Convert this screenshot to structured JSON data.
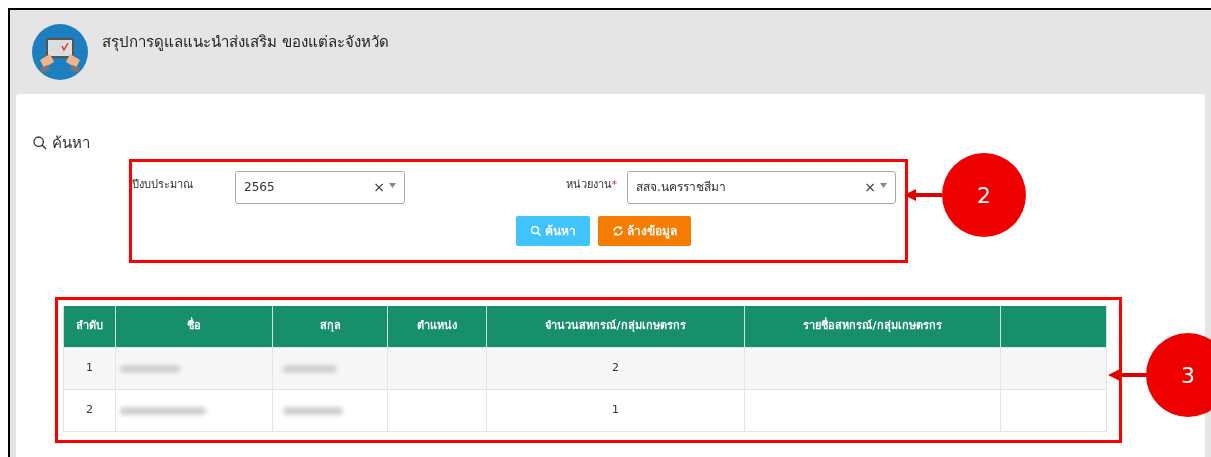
{
  "header": {
    "title": "สรุปการดูแลแนะนำส่งเสริม ของแต่ละจังหวัด"
  },
  "search": {
    "heading": "ค้นหา",
    "fields": [
      {
        "label": "ปีงบประมาณ",
        "value": "2565",
        "clear": "×"
      },
      {
        "label": "หน่วยงาน",
        "required_mark": "*",
        "value": "สสจ.นครราชสีมา",
        "clear": "×"
      }
    ],
    "buttons": [
      {
        "kind": "search",
        "label": "ค้นหา"
      },
      {
        "kind": "reset",
        "label": "ล้างข้อมูล"
      }
    ]
  },
  "table": {
    "columns": [
      "ลำดับ",
      "ชื่อ",
      "สกุล",
      "ตำแหน่ง",
      "จำนวนสหกรณ์/กลุ่มเกษตรกร",
      "รายชื่อสหกรณ์/กลุ่มเกษตรกร",
      ""
    ],
    "rows": [
      {
        "index": "1",
        "count": "2"
      },
      {
        "index": "2",
        "count": "1"
      }
    ]
  },
  "callouts": [
    {
      "label": "2"
    },
    {
      "label": "3"
    }
  ]
}
